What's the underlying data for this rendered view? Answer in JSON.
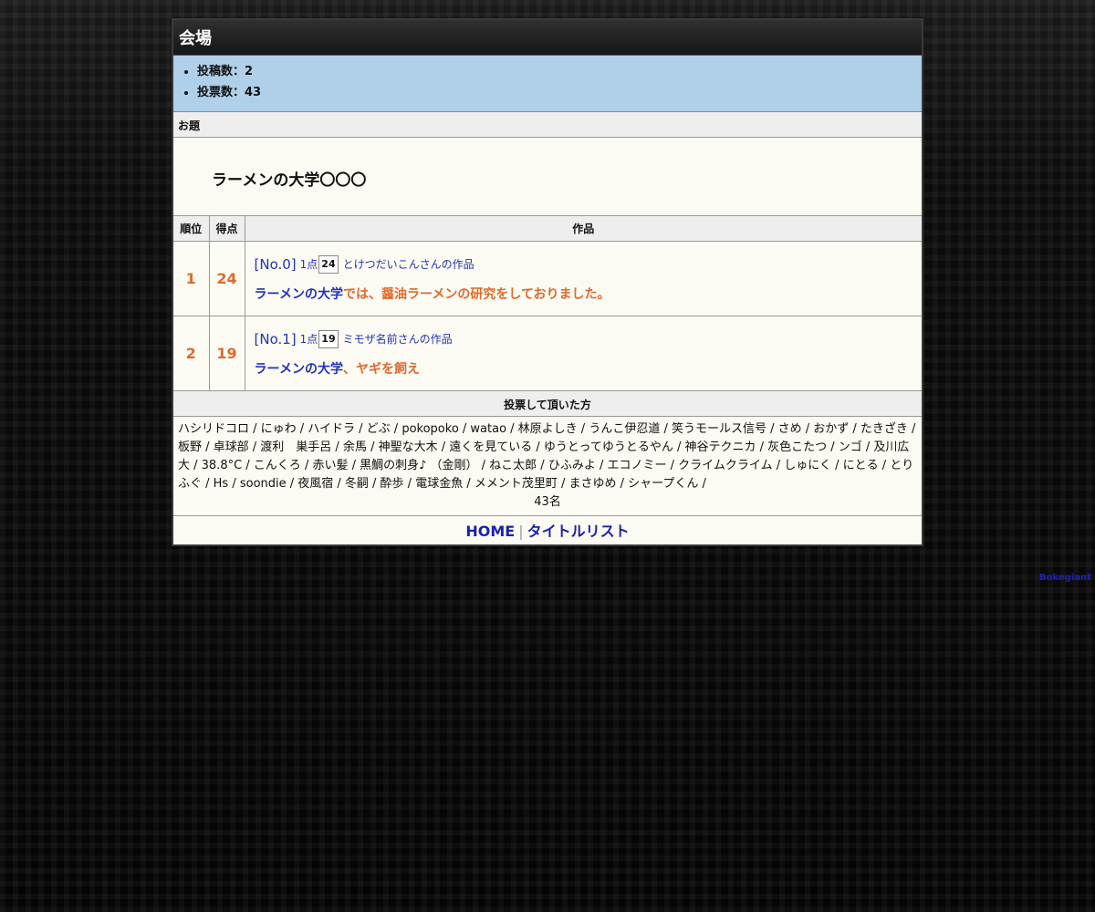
{
  "venue": {
    "title": "会場",
    "stats": [
      "投稿数：2",
      "投票数：43"
    ]
  },
  "theme": {
    "label": "お題",
    "text": "ラーメンの大学〇〇〇"
  },
  "ranking": {
    "headers": {
      "rank": "順位",
      "score": "得点",
      "work": "作品"
    },
    "rows": [
      {
        "rank": "1",
        "score": "24",
        "no": "[No.0]",
        "point_label": "1点",
        "points": "24",
        "author": "とけつだいこんさんの作品",
        "head": "ラーメンの大学",
        "body": "では、醤油ラーメンの研究をしておりました。"
      },
      {
        "rank": "2",
        "score": "19",
        "no": "[No.1]",
        "point_label": "1点",
        "points": "19",
        "author": "ミモザ名前さんの作品",
        "head": "ラーメンの大学",
        "body": "、ヤギを飼え"
      }
    ]
  },
  "voters": {
    "label": "投票して頂いた方",
    "names": "ハシリドコロ / にゅわ / ハイドラ / どぶ / pokopoko / watao / 林原よしき / うんこ伊忍道 / 笑うモールス信号 / さめ / おかず / たきざき / 板野 / 卓球部 / 渡利　巣手呂 / 余馬 / 神聖な大木 / 遠くを見ている / ゆうとってゆうとるやん / 神谷テクニカ / 灰色こたつ / ンゴ / 及川広大 / 38.8°C / こんくろ / 赤い髪 / 黒鯛の刺身♪ （金剛） / ねこ太郎 / ひふみよ / エコノミー / クライムクライム / しゅにく / にとる / とりふぐ / Hs / soondie / 夜風宿 / 冬嗣 / 酔歩 / 電球金魚 / メメント茂里町 / まさゆめ / シャープくん /",
    "count": "43名"
  },
  "footer": {
    "home": "HOME",
    "separator": "|",
    "title_list": "タイトルリスト"
  },
  "corner_link": "Bokegiant"
}
